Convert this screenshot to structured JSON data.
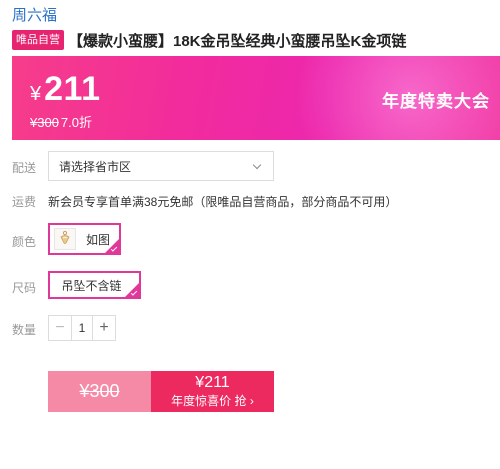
{
  "brand": "周六福",
  "product": {
    "badge": "唯品自营",
    "title": "【爆款小蛮腰】18K金吊坠经典小蛮腰吊坠K金项链"
  },
  "banner": {
    "currency": "¥",
    "price": "211",
    "original_price": "¥300",
    "discount": "7.0折",
    "promo_title": "年度特卖大会"
  },
  "delivery": {
    "label": "配送",
    "placeholder": "请选择省市区"
  },
  "shipping": {
    "label": "运费",
    "text": "新会员专享首单满38元免邮（限唯品自营商品，部分商品不可用）"
  },
  "color": {
    "label": "颜色",
    "selected": "如图"
  },
  "size": {
    "label": "尺码",
    "selected": "吊坠不含链"
  },
  "quantity": {
    "label": "数量",
    "value": "1",
    "minus": "−",
    "plus": "+"
  },
  "buy": {
    "original_price": "¥300",
    "price": "¥211",
    "cta": "年度惊喜价 抢 ›"
  },
  "colors": {
    "accent": "#e72470",
    "banner_start": "#f63d8a",
    "banner_end": "#ec27ad",
    "selection_border": "#e0389a",
    "buy_left": "#f48aa6",
    "buy_right": "#ec2a60",
    "brand_link": "#2a72c8"
  },
  "icons": {
    "select_arrow": "chevron-down-icon",
    "selected_mark": "checkmark-icon",
    "color_thumb": "pendant-thumbnail"
  }
}
